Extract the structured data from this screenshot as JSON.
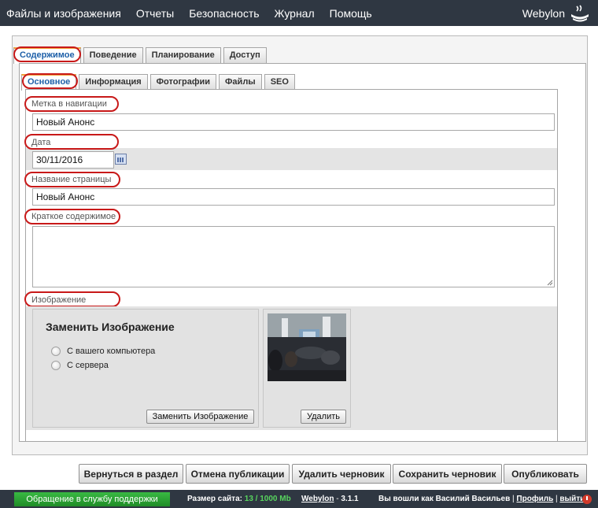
{
  "topbar": {
    "menu": [
      "Файлы и изображения",
      "Отчеты",
      "Безопасность",
      "Журнал",
      "Помощь"
    ],
    "brand": "Webylon"
  },
  "tabs": [
    "Содержимое",
    "Поведение",
    "Планирование",
    "Доступ"
  ],
  "subtabs": [
    "Основное",
    "Информация",
    "Фотографии",
    "Файлы",
    "SEO"
  ],
  "form": {
    "nav_label": {
      "label": "Метка в навигации",
      "value": "Новый Анонс"
    },
    "date": {
      "label": "Дата",
      "value": "30/11/2016"
    },
    "page_title": {
      "label": "Название страницы",
      "value": "Новый Анонс"
    },
    "summary": {
      "label": "Краткое содержимое",
      "value": ""
    },
    "image": {
      "label": "Изображение",
      "replace_title": "Заменить Изображение",
      "options": [
        "С вашего компьютера",
        "С сервера"
      ],
      "replace_button": "Заменить Изображение",
      "delete_button": "Удалить"
    }
  },
  "actions": [
    "Вернуться в раздел",
    "Отмена публикации",
    "Удалить черновик",
    "Сохранить черновик",
    "Опубликовать"
  ],
  "statusbar": {
    "support": "Обращение в службу поддержки",
    "size_label": "Размер сайта:",
    "size_value": "13 / 1000 Mb",
    "product": "Webylon",
    "version": "3.1.1",
    "logged_prefix": "Вы вошли как",
    "user": "Василий Васильев",
    "profile": "Профиль",
    "logout": "выйти"
  },
  "colors": {
    "topbar": "#2f3742",
    "active_tab_text": "#1d5fa8",
    "highlight": "#c81919",
    "support_button": "#2aa834"
  }
}
